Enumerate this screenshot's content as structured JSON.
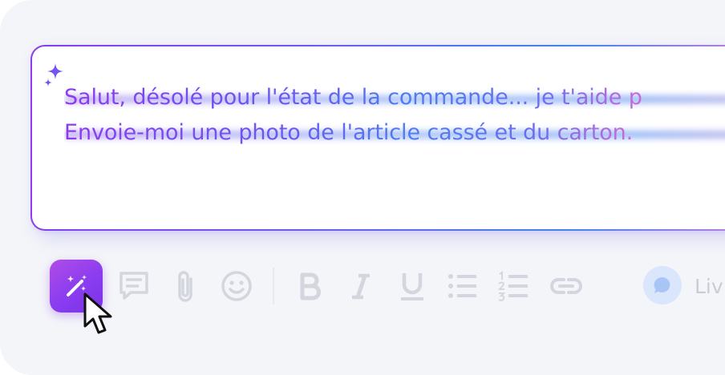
{
  "composer": {
    "lines": [
      "Salut, désolé pour l'état de la commande... je t'aide p",
      "Envoie-moi une photo de l'article cassé et du carton."
    ]
  },
  "toolbar": {
    "magic_icon": "magic-wand-icon",
    "tools": [
      "chat-note-icon",
      "attachment-icon",
      "emoji-icon",
      "bold-icon",
      "italic-icon",
      "underline-icon",
      "bulleted-list-icon",
      "numbered-list-icon",
      "link-icon"
    ]
  },
  "live": {
    "label": "Liv",
    "icon": "chat-bubble-icon"
  },
  "colors": {
    "accent_purple": "#8a3cf0",
    "accent_blue": "#4f7cf0",
    "accent_pink": "#c86ad8",
    "tool_gray": "#d3d6de",
    "panel_bg": "#f4f5f9"
  }
}
